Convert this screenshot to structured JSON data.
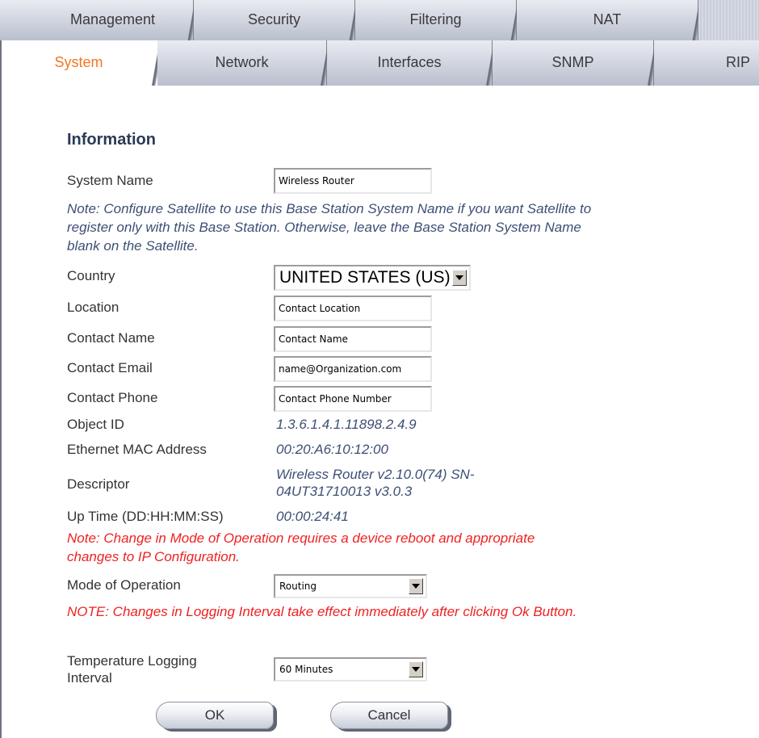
{
  "tabs": {
    "top": [
      {
        "label": "Management"
      },
      {
        "label": "Security"
      },
      {
        "label": "Filtering"
      },
      {
        "label": "NAT"
      }
    ],
    "bottom": [
      {
        "label": "System",
        "active": true
      },
      {
        "label": "Network"
      },
      {
        "label": "Interfaces"
      },
      {
        "label": "SNMP"
      },
      {
        "label": "RIP"
      }
    ]
  },
  "heading": "Information",
  "system_name": {
    "label": "System Name",
    "value": "Wireless Router"
  },
  "note1": "Note: Configure Satellite to use this Base Station System Name if you want Satellite to register only with this Base Station. Otherwise, leave the Base Station System Name blank on the Satellite.",
  "country": {
    "label": "Country",
    "value": "UNITED STATES (US)"
  },
  "location": {
    "label": "Location",
    "value": "Contact Location"
  },
  "contact_name": {
    "label": "Contact Name",
    "value": "Contact Name"
  },
  "contact_email": {
    "label": "Contact Email",
    "value": "name@Organization.com"
  },
  "contact_phone": {
    "label": "Contact Phone",
    "value": "Contact Phone Number"
  },
  "object_id": {
    "label": "Object ID",
    "value": "1.3.6.1.4.1.11898.2.4.9"
  },
  "mac": {
    "label": "Ethernet MAC Address",
    "value": "00:20:A6:10:12:00"
  },
  "descriptor": {
    "label": "Descriptor",
    "line1": "Wireless Router v2.10.0(74) SN-",
    "line2": "04UT31710013 v3.0.3"
  },
  "uptime": {
    "label": "Up Time (DD:HH:MM:SS)",
    "value": "00:00:24:41"
  },
  "note2": "Note: Change in Mode of Operation requires a device reboot and appropriate changes to IP Configuration.",
  "mode": {
    "label": "Mode of Operation",
    "value": "Routing"
  },
  "note3": "NOTE: Changes in Logging Interval take effect immediately after clicking Ok Button.",
  "temp_logging": {
    "label_line1": "Temperature Logging",
    "label_line2": "Interval",
    "value": "60 Minutes"
  },
  "buttons": {
    "ok": "OK",
    "cancel": "Cancel"
  },
  "colors": {
    "active_tab": "#f37621",
    "heading": "#2b3a55",
    "note": "#3d4f75",
    "warning": "#ee2222"
  }
}
